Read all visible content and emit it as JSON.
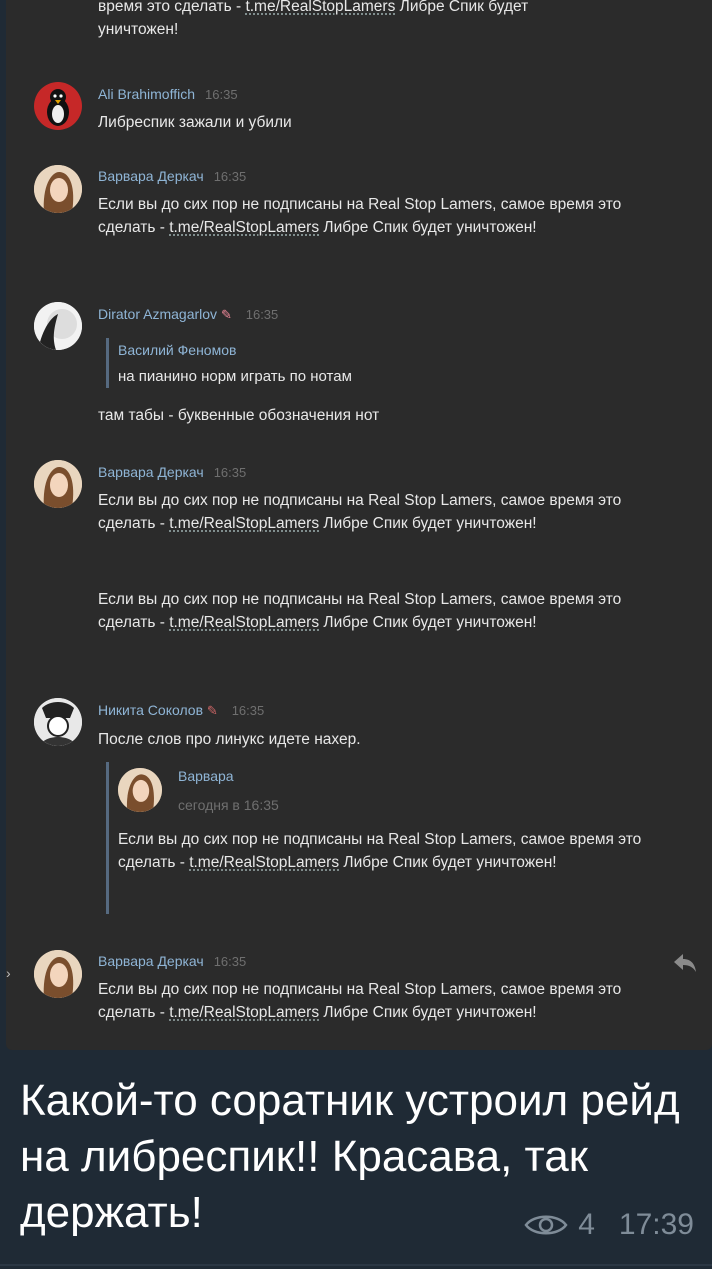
{
  "top_cut": {
    "line1_a": "время это сделать - ",
    "line1_link": "t.me/RealStopLamers",
    "line1_b": " Либре Спик будет",
    "line2": "уничтожен!"
  },
  "messages": [
    {
      "author": "Ali Brahimoffich",
      "time": "16:35",
      "text": "Либреспик зажали и убили"
    },
    {
      "author": "Варвара Деркач",
      "time": "16:35",
      "text_a": "Если вы до сих пор не подписаны на Real Stop Lamers, самое время это сделать - ",
      "link": "t.me/RealStopLamers",
      "text_b": " Либре Спик будет уничтожен!"
    },
    {
      "author": "Dirator Azmagarlov",
      "time": "16:35",
      "quote_author": "Василий Феномов",
      "quote_text": "на пианино норм играть по нотам",
      "text": "там табы - буквенные обозначения нот"
    },
    {
      "author": "Варвара Деркач",
      "time": "16:35",
      "text_a": "Если вы до сих пор не подписаны на Real Stop Lamers, самое время это сделать - ",
      "link": "t.me/RealStopLamers",
      "text_b": " Либре Спик будет уничтожен!",
      "text2_a": "Если вы до сих пор не подписаны на Real Stop Lamers, самое время это сделать - ",
      "link2": "t.me/RealStopLamers",
      "text2_b": " Либре Спик будет уничтожен!"
    },
    {
      "author": "Никита Соколов",
      "time": "16:35",
      "text": "После слов про линукс идете нахер.",
      "reply_author": "Варвара",
      "reply_time": "сегодня в 16:35",
      "reply_text_a": "Если вы до сих пор не подписаны на Real Stop Lamers, самое время это сделать - ",
      "reply_link": "t.me/RealStopLamers",
      "reply_text_b": " Либре Спик будет уничтожен!"
    },
    {
      "author": "Варвара Деркач",
      "time": "16:35",
      "text_a": "Если вы до сих пор не подписаны на Real Stop Lamers, самое время это сделать - ",
      "link": "t.me/RealStopLamers",
      "text_b": " Либре Спик будет уничтожен!"
    }
  ],
  "post": {
    "caption": "Какой-то соратник устроил рейд на либреспик!! Красава, так держать!",
    "views": "4",
    "time": "17:39"
  },
  "icons": {
    "views": "eye-icon",
    "reply": "reply-arrow-icon"
  }
}
